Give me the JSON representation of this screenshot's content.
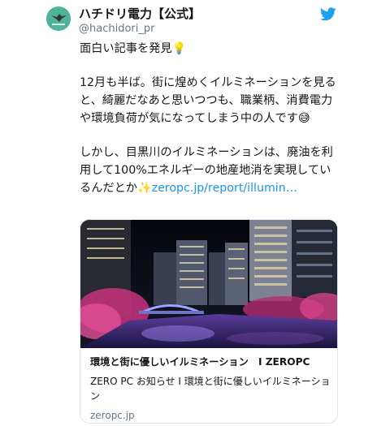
{
  "author": {
    "name": "ハチドリ電力【公式】",
    "handle": "@hachidori_pr",
    "avatar_icon": "hummingbird-logo",
    "avatar_text": "ハチドリ電力"
  },
  "twitter_icon": "twitter-bird-icon",
  "tweet": {
    "p1": "面白い記事を発見",
    "p1_emoji": "💡",
    "p2": "12月も半ば。街に煌めくイルミネーションを見ると、綺麗だなあと思いつつも、職業柄、消費電力や環境負荷が気になってしまう中の人です",
    "p2_emoji": "😅",
    "p3": "しかし、目黒川のイルミネーションは、廃油を利用して100%エネルギーの地産地消を実現しているんだとか",
    "p3_emoji": "✨",
    "link": "zeropc.jp/report/illumin…"
  },
  "card": {
    "title": "環境と街に優しいイルミネーション　I ZEROPC",
    "description": "ZERO PC お知らせ I 環境と街に優しいイルミネーション",
    "domain": "zeropc.jp"
  },
  "colors": {
    "link": "#1b95e0",
    "twitter_blue": "#1da1f2",
    "avatar": "#4fb39a"
  }
}
